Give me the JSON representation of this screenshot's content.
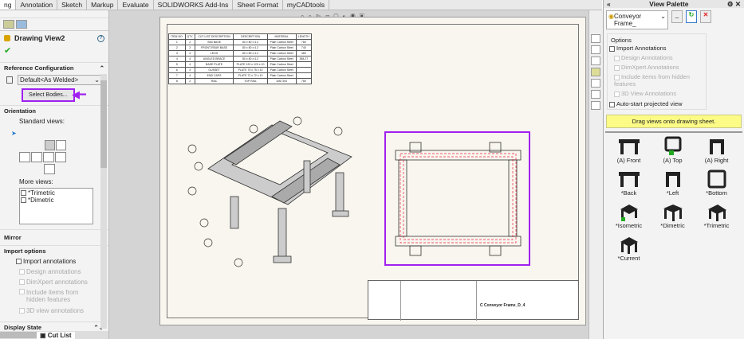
{
  "tabs": [
    "ng",
    "Annotation",
    "Sketch",
    "Markup",
    "Evaluate",
    "SOLIDWORKS Add-Ins",
    "Sheet Format",
    "myCADtools"
  ],
  "left": {
    "title": "Drawing View2",
    "ref_config_header": "Reference Configuration",
    "config_value": "Default<As Welded>",
    "select_bodies": "Select Bodies...",
    "orientation_header": "Orientation",
    "standard_views": "Standard views:",
    "more_views": "More views:",
    "more_views_items": [
      "*Trimetric",
      "*Dimetric"
    ],
    "mirror_header": "Mirror",
    "import_header": "Import options",
    "import_annotations": "Import annotations",
    "import_sub": [
      "Design annotations",
      "DimXpert annotations",
      "Include items from hidden features",
      "3D view annotations"
    ],
    "display_state": "Display State",
    "bottom_tab": "Cut List",
    "highlight_color": "#a020f0"
  },
  "bom": {
    "headers": [
      "ITEM NO.",
      "QTY.",
      "CUT-LIST DESCRIPTION",
      "DESCRIPTION",
      "MATERIAL",
      "LENGTH"
    ],
    "rows": [
      [
        "1",
        "2",
        "SB3 BASE",
        "80 x 80 x 4.2",
        "Plain Carbon Steel",
        "780"
      ],
      [
        "2",
        "2",
        "FRONT-REAR BASE",
        "80 x 80 x 4.2",
        "Plain Carbon Steel",
        "740"
      ],
      [
        "3",
        "4",
        "LEGS",
        "80 x 80 x 4.2",
        "Plain Carbon Steel",
        "480"
      ],
      [
        "4",
        "4",
        "ANGLED BRACE",
        "80 x 80 x 4.2",
        "Plain Carbon Steel",
        "358.27"
      ],
      [
        "5",
        "4",
        "BASE PLATE",
        "PLATE 120 x 120 x 10",
        "Plain Carbon Steel",
        ""
      ],
      [
        "6",
        "4",
        "GUSSET",
        "PLATE 75 x 75 x 10",
        "Plain Carbon Steel",
        ""
      ],
      [
        "7",
        "4",
        "END CAPS",
        "PLATE 72 x 72 x 10",
        "Plain Carbon Steel",
        ""
      ],
      [
        "8",
        "2",
        "RAIL",
        "TOP RAIL",
        "AISI 304",
        "780"
      ]
    ]
  },
  "title_block": {
    "name": "Conveyor Frame_D_4",
    "size": "C"
  },
  "palette": {
    "title": "View Palette",
    "doc": "Conveyor Frame_",
    "options": "Options",
    "import_annotations": "Import Annotations",
    "sub": [
      "Design Annotations",
      "DimXpert Annotations",
      "Include items from hidden features",
      "3D View Annotations"
    ],
    "auto_start": "Auto-start projected view",
    "hint": "Drag views onto drawing sheet.",
    "views": [
      "(A) Front",
      "(A) Top",
      "(A) Right",
      "*Back",
      "*Left",
      "*Bottom",
      "*Isometric",
      "*Dimetric",
      "*Trimetric",
      "*Current"
    ]
  }
}
